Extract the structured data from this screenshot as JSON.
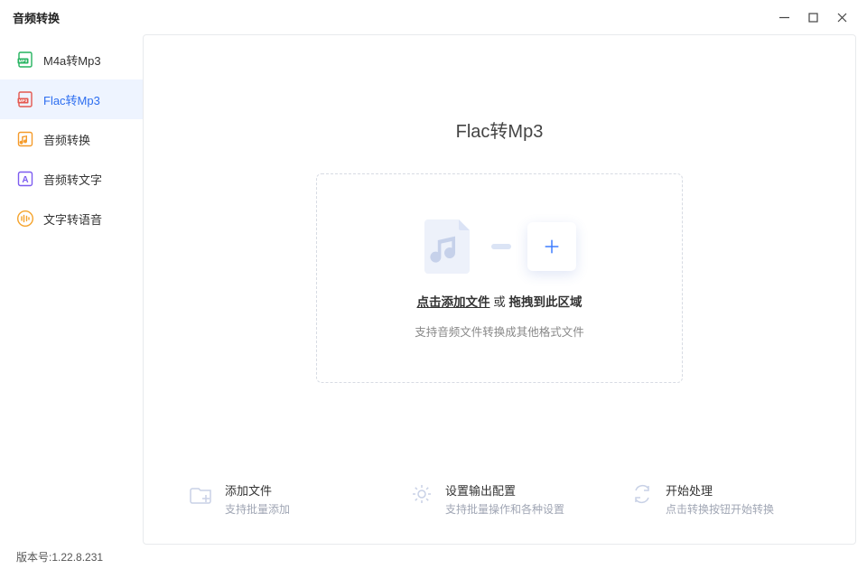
{
  "title": "音频转换",
  "sidebar": {
    "items": [
      {
        "label": "M4a转Mp3"
      },
      {
        "label": "Flac转Mp3"
      },
      {
        "label": "音频转换"
      },
      {
        "label": "音频转文字"
      },
      {
        "label": "文字转语音"
      }
    ]
  },
  "main": {
    "page_title": "Flac转Mp3",
    "drop": {
      "click_label": "点击添加文件",
      "or": " 或 ",
      "drag_label": "拖拽到此区域",
      "hint": "支持音频文件转换成其他格式文件"
    }
  },
  "steps": [
    {
      "title": "添加文件",
      "sub": "支持批量添加"
    },
    {
      "title": "设置输出配置",
      "sub": "支持批量操作和各种设置"
    },
    {
      "title": "开始处理",
      "sub": "点击转换按钮开始转换"
    }
  ],
  "footer": {
    "version_text": "版本号:1.22.8.231"
  }
}
